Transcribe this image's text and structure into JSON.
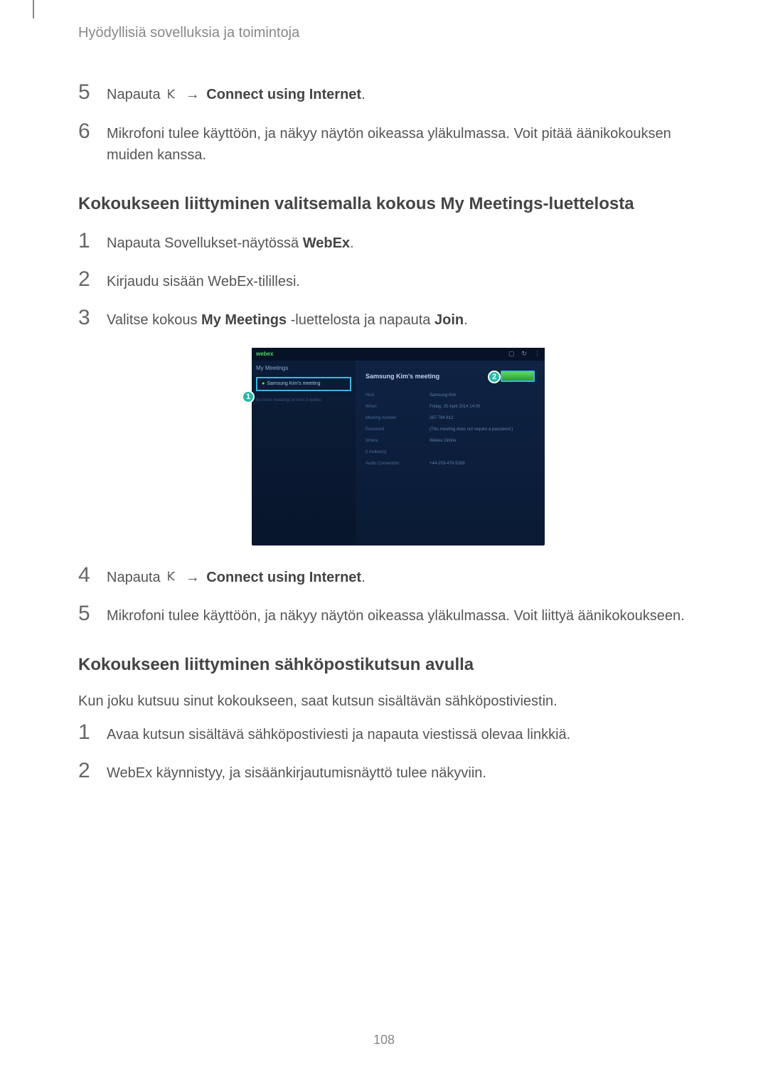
{
  "breadcrumb": "Hyödyllisiä sovelluksia ja toimintoja",
  "steps_a": [
    {
      "num": "5",
      "pre": "Napauta ",
      "icon": true,
      "arrow": " → ",
      "bold": "Connect using Internet",
      "post": "."
    },
    {
      "num": "6",
      "text_before_icon": "Mikrofoni tulee käyttöön, ja ",
      "icon_inline": "",
      "text_after": " näkyy näytön oikeassa yläkulmassa. Voit pitää äänikokouksen muiden kanssa."
    }
  ],
  "section1": "Kokoukseen liittyminen valitsemalla kokous My Meetings-luettelosta",
  "steps_b": [
    {
      "num": "1",
      "text": "Napauta Sovellukset-näytössä ",
      "bold": "WebEx",
      "post": "."
    },
    {
      "num": "2",
      "text": "Kirjaudu sisään WebEx-tilillesi."
    },
    {
      "num": "3",
      "text": "Valitse kokous ",
      "bold": "My Meetings",
      "mid": " -luettelosta ja napauta ",
      "bold2": "Join",
      "post": "."
    }
  ],
  "steps_c": [
    {
      "num": "4",
      "pre": "Napauta ",
      "icon": true,
      "arrow": " → ",
      "bold": "Connect using Internet",
      "post": "."
    },
    {
      "num": "5",
      "text_before_icon": "Mikrofoni tulee käyttöön, ja ",
      "icon_inline": "",
      "text_after": " näkyy näytön oikeassa yläkulmassa. Voit liittyä äänikokoukseen."
    }
  ],
  "section2": "Kokoukseen liittyminen sähköpostikutsun avulla",
  "intro2": "Kun joku kutsuu sinut kokoukseen, saat kutsun sisältävän sähköpostiviestin.",
  "steps_d": [
    {
      "num": "1",
      "text": "Avaa kutsun sisältävä sähköpostiviesti ja napauta viestissä olevaa linkkiä."
    },
    {
      "num": "2",
      "text": "WebEx käynnistyy, ja sisäänkirjautumisnäyttö tulee näkyviin."
    }
  ],
  "page_number": "108",
  "screenshot": {
    "logo": "webex",
    "my_meetings": "My Meetings",
    "item_title": "Samsung Kim's meeting",
    "faint_line": "No more meetings in next 3 weeks",
    "main_title": "Samsung Kim's meeting",
    "callout1": "1",
    "callout2": "2",
    "fields": {
      "host_label": "Host",
      "host_value": "Samsung Kim",
      "when_label": "When",
      "when_value": "Friday, 25 April 2014 14:00",
      "num_label": "Meeting number",
      "num_value": "287 784 812",
      "pass_label": "Password",
      "pass_value": "(This meeting does not require a password.)",
      "where_label": "Where",
      "where_value": "Webex Online",
      "invite_label": "0 invitee(s)",
      "audio_label": "Audio Connection",
      "audio_value": "+44-203-478-5289"
    }
  }
}
